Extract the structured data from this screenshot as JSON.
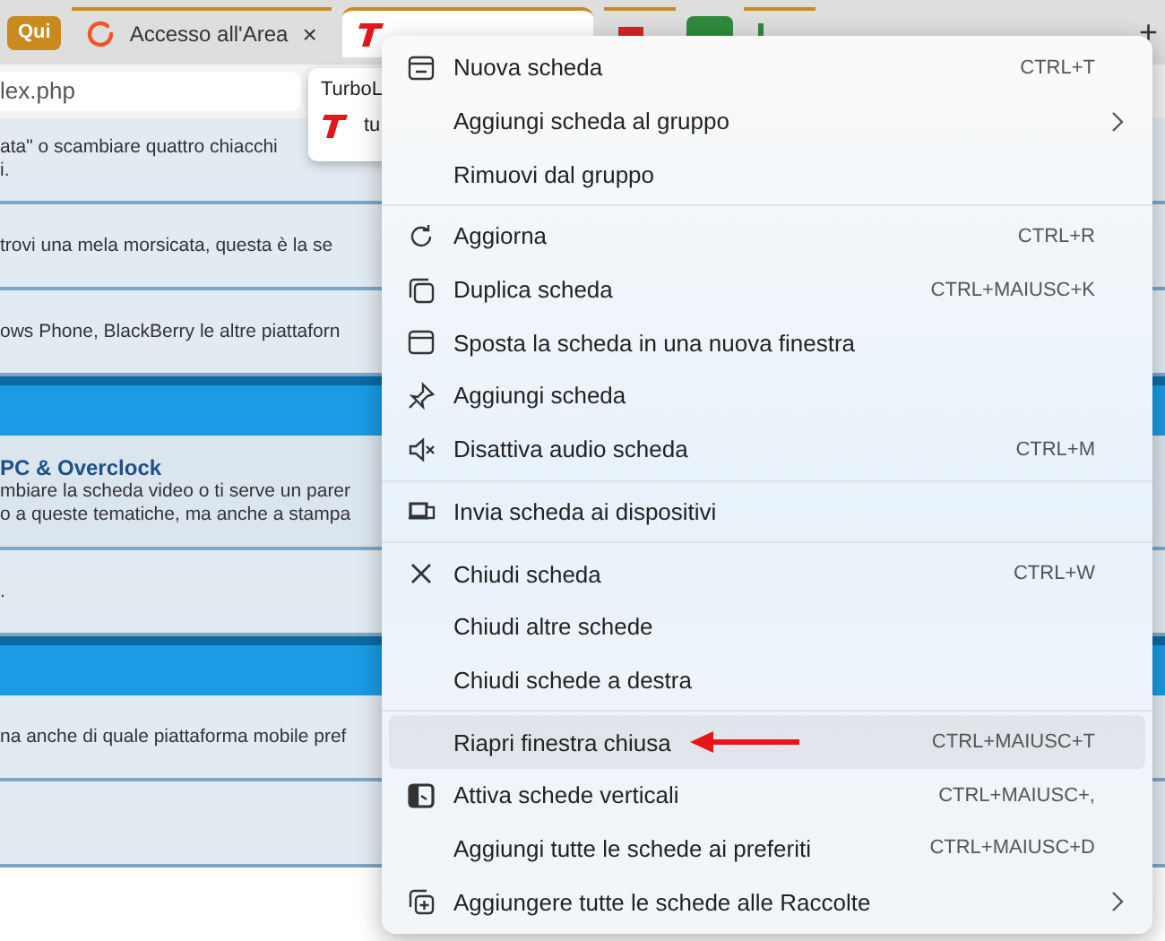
{
  "tabs": [
    {
      "kind": "group",
      "label": "Qui",
      "color": "#c98a1f"
    },
    {
      "kind": "tab",
      "label": "Accesso all'Area",
      "close": "×",
      "selected": false
    },
    {
      "kind": "tab",
      "selected": true
    },
    {
      "kind": "tab",
      "selected": false
    },
    {
      "kind": "group",
      "color": "#2f8a3c"
    },
    {
      "kind": "tab",
      "selected": false
    }
  ],
  "new_tab": "+",
  "address_bar": {
    "value": "lex.php"
  },
  "tooltip": {
    "title": "TurboL",
    "url": "tu"
  },
  "page": {
    "blocks": [
      {
        "kind": "row",
        "lines": [
          "ata\" o scambiare quattro chiacchi",
          "i."
        ]
      },
      {
        "kind": "row",
        "lines": [
          "trovi una mela morsicata, questa è la se"
        ]
      },
      {
        "kind": "row",
        "lines": [
          "ows Phone, BlackBerry le altre piattaforn"
        ]
      },
      {
        "kind": "header"
      },
      {
        "kind": "forum",
        "title": "PC & Overclock",
        "lines": [
          "mbiare la scheda video o ti serve un parer",
          "o a queste tematiche, ma anche a stampa"
        ]
      },
      {
        "kind": "row",
        "lines": [
          "."
        ]
      },
      {
        "kind": "header"
      },
      {
        "kind": "row",
        "lines": [
          "na anche di quale piattaforma mobile pref"
        ]
      },
      {
        "kind": "row"
      }
    ]
  },
  "menu": {
    "sections": [
      {
        "items": [
          {
            "label": "Nuova scheda",
            "shortcut": "CTRL+T",
            "submenu": false,
            "selected": false
          },
          {
            "label": "Aggiungi scheda al gruppo",
            "submenu": true,
            "selected": false
          },
          {
            "label": "Rimuovi dal gruppo",
            "submenu": false,
            "selected": false
          }
        ]
      },
      {
        "items": [
          {
            "label": "Aggiorna",
            "shortcut": "CTRL+R",
            "submenu": false,
            "selected": false
          },
          {
            "label": "Duplica scheda",
            "shortcut": "CTRL+MAIUSC+K",
            "submenu": false,
            "selected": false
          },
          {
            "label": "Sposta la scheda in una nuova finestra",
            "submenu": false,
            "selected": false
          },
          {
            "label": "Aggiungi scheda",
            "submenu": false,
            "selected": false
          },
          {
            "label": "Disattiva audio scheda",
            "shortcut": "CTRL+M",
            "submenu": false,
            "selected": false
          }
        ]
      },
      {
        "items": [
          {
            "label": "Invia scheda ai dispositivi",
            "submenu": false,
            "selected": false
          }
        ]
      },
      {
        "items": [
          {
            "label": "Chiudi scheda",
            "shortcut": "CTRL+W",
            "submenu": false,
            "selected": false
          },
          {
            "label": "Chiudi altre schede",
            "submenu": false,
            "selected": false
          },
          {
            "label": "Chiudi schede a destra",
            "submenu": false,
            "selected": false
          }
        ]
      },
      {
        "items": [
          {
            "label": "Riapri finestra chiusa",
            "shortcut": "CTRL+MAIUSC+T",
            "submenu": false,
            "selected": true
          },
          {
            "label": "Attiva schede verticali",
            "shortcut": "CTRL+MAIUSC+,",
            "submenu": false,
            "selected": false
          },
          {
            "label": "Aggiungi tutte le schede ai preferiti",
            "shortcut": "CTRL+MAIUSC+D",
            "submenu": false,
            "selected": false
          },
          {
            "label": "Aggiungere tutte le schede alle Raccolte",
            "submenu": true,
            "selected": false
          }
        ]
      }
    ]
  }
}
